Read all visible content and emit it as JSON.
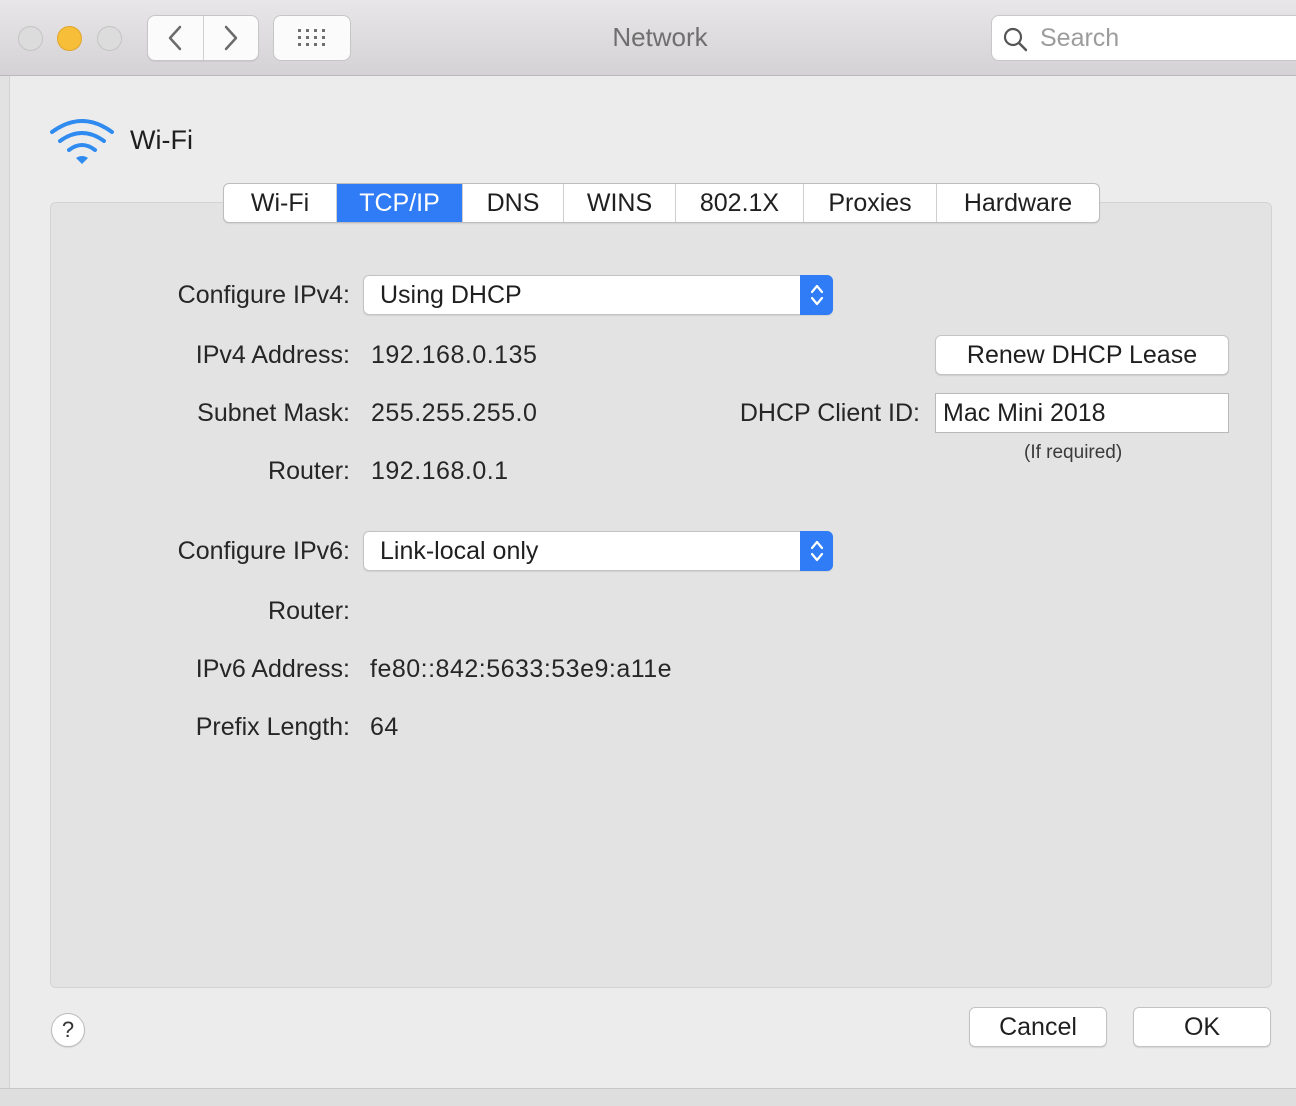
{
  "window": {
    "title": "Network",
    "search_placeholder": "Search"
  },
  "service": {
    "name": "Wi-Fi",
    "icon": "wifi-icon"
  },
  "tabs": [
    {
      "label": "Wi-Fi",
      "active": false
    },
    {
      "label": "TCP/IP",
      "active": true
    },
    {
      "label": "DNS",
      "active": false
    },
    {
      "label": "WINS",
      "active": false
    },
    {
      "label": "802.1X",
      "active": false
    },
    {
      "label": "Proxies",
      "active": false
    },
    {
      "label": "Hardware",
      "active": false
    }
  ],
  "ipv4": {
    "configure_label": "Configure IPv4:",
    "configure_value": "Using DHCP",
    "address_label": "IPv4 Address:",
    "address_value": "192.168.0.135",
    "subnet_label": "Subnet Mask:",
    "subnet_value": "255.255.255.0",
    "router_label": "Router:",
    "router_value": "192.168.0.1"
  },
  "dhcp": {
    "renew_button": "Renew DHCP Lease",
    "client_id_label": "DHCP Client ID:",
    "client_id_value": "Mac Mini 2018",
    "client_id_hint": "(If required)"
  },
  "ipv6": {
    "configure_label": "Configure IPv6:",
    "configure_value": "Link-local only",
    "router_label": "Router:",
    "router_value": "",
    "address_label": "IPv6 Address:",
    "address_value": "fe80::842:5633:53e9:a11e",
    "prefix_label": "Prefix Length:",
    "prefix_value": "64"
  },
  "footer": {
    "help_label": "?",
    "cancel_button": "Cancel",
    "ok_button": "OK"
  },
  "colors": {
    "accent": "#2f7cf6",
    "minimize": "#f7be39"
  }
}
